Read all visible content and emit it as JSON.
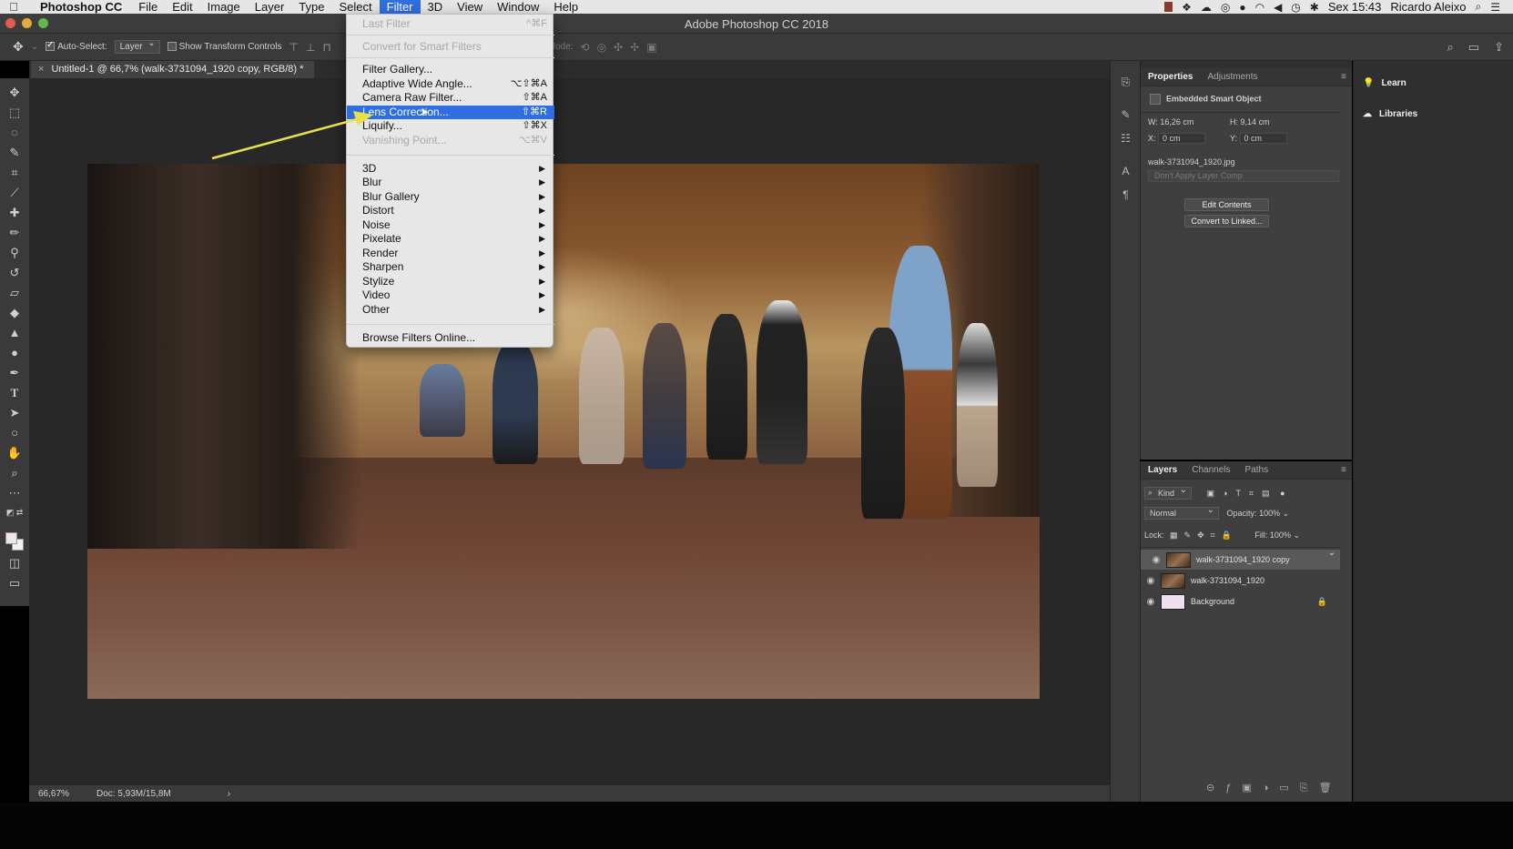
{
  "menubar": {
    "app": "Photoshop CC",
    "items": [
      "File",
      "Edit",
      "Image",
      "Layer",
      "Type",
      "Select",
      "Filter",
      "3D",
      "View",
      "Window",
      "Help"
    ],
    "active_index": 6,
    "clock": "Sex 15:43",
    "user": "Ricardo Aleixo"
  },
  "window": {
    "title": "Adobe Photoshop CC 2018"
  },
  "options_bar": {
    "auto_select_label": "Auto-Select:",
    "auto_select_value": "Layer",
    "show_transform_label": "Show Transform Controls",
    "mode_label": "Mode:"
  },
  "document": {
    "tab_title": "Untitled-1 @ 66,7% (walk-3731094_1920 copy, RGB/8) *",
    "zoom": "66,67%",
    "doc_size": "Doc: 5,93M/15,8M"
  },
  "filter_menu": {
    "items": [
      {
        "label": "Last Filter",
        "shortcut": "^⌘F",
        "disabled": true
      },
      {
        "label": "Convert for Smart Filters",
        "shortcut": "",
        "disabled": true
      },
      {
        "label": "Filter Gallery...",
        "shortcut": ""
      },
      {
        "label": "Adaptive Wide Angle...",
        "shortcut": "⌥⇧⌘A"
      },
      {
        "label": "Camera Raw Filter...",
        "shortcut": "⇧⌘A"
      },
      {
        "label": "Lens Correction...",
        "shortcut": "⇧⌘R",
        "highlighted": true
      },
      {
        "label": "Liquify...",
        "shortcut": "⇧⌘X"
      },
      {
        "label": "Vanishing Point...",
        "shortcut": "⌥⌘V",
        "disabled": true
      },
      {
        "label": "3D",
        "submenu": true
      },
      {
        "label": "Blur",
        "submenu": true
      },
      {
        "label": "Blur Gallery",
        "submenu": true
      },
      {
        "label": "Distort",
        "submenu": true
      },
      {
        "label": "Noise",
        "submenu": true
      },
      {
        "label": "Pixelate",
        "submenu": true
      },
      {
        "label": "Render",
        "submenu": true
      },
      {
        "label": "Sharpen",
        "submenu": true
      },
      {
        "label": "Stylize",
        "submenu": true
      },
      {
        "label": "Video",
        "submenu": true
      },
      {
        "label": "Other",
        "submenu": true
      },
      {
        "label": "Browse Filters Online..."
      }
    ]
  },
  "properties": {
    "tabs": [
      "Properties",
      "Adjustments"
    ],
    "object_type": "Embedded Smart Object",
    "w_label": "W:",
    "w_value": "16,26 cm",
    "h_label": "H:",
    "h_value": "9,14 cm",
    "x_label": "X:",
    "x_value": "0 cm",
    "y_label": "Y:",
    "y_value": "0 cm",
    "filename": "walk-3731094_1920.jpg",
    "layer_comp": "Don't Apply Layer Comp",
    "edit_contents": "Edit Contents",
    "convert_linked": "Convert to Linked..."
  },
  "layers": {
    "tabs": [
      "Layers",
      "Channels",
      "Paths"
    ],
    "filter_kind": "Kind",
    "blend_mode": "Normal",
    "opacity_label": "Opacity:",
    "opacity_value": "100%",
    "lock_label": "Lock:",
    "fill_label": "Fill:",
    "fill_value": "100%",
    "items": [
      {
        "name": "walk-3731094_1920 copy",
        "selected": true
      },
      {
        "name": "walk-3731094_1920",
        "selected": false
      },
      {
        "name": "Background",
        "selected": false,
        "locked": true
      }
    ]
  },
  "learn_panel": {
    "learn": "Learn",
    "libraries": "Libraries"
  },
  "colors": {
    "menu_highlight": "#2f6ee0",
    "annotation_arrow": "#e8e04a"
  }
}
